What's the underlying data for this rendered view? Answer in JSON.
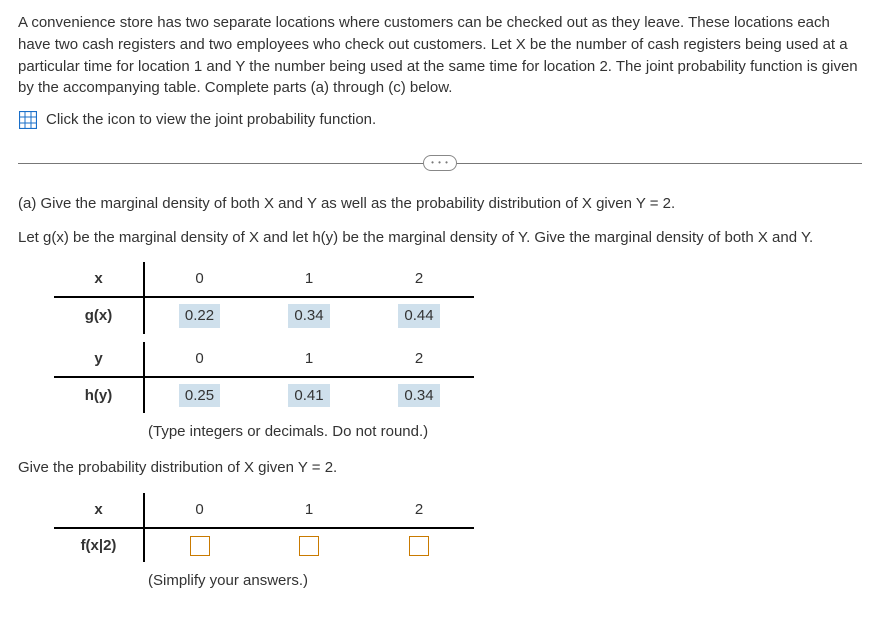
{
  "problem": {
    "text": "A convenience store has two separate locations where customers can be checked out as they leave. These locations each have two cash registers and two employees who check out customers. Let X be the number of cash registers being used at a particular time for location 1 and Y the number being used at the same time for location 2. The joint probability function is given by the accompanying table. Complete parts (a) through (c) below.",
    "iconLink": "Click the icon to view the joint probability function."
  },
  "partA": {
    "label": "(a) Give the marginal density of both X and Y as well as the probability distribution of X given Y = 2.",
    "instr": "Let g(x) be the marginal density of X and let h(y) be the marginal density of Y. Give the marginal density of both X and Y."
  },
  "gx": {
    "rowLabel": "x",
    "fnLabel": "g(x)",
    "cols": [
      "0",
      "1",
      "2"
    ],
    "vals": [
      "0.22",
      "0.34",
      "0.44"
    ]
  },
  "hy": {
    "rowLabel": "y",
    "fnLabel": "h(y)",
    "cols": [
      "0",
      "1",
      "2"
    ],
    "vals": [
      "0.25",
      "0.41",
      "0.34"
    ]
  },
  "hint1": "(Type integers or decimals. Do not round.)",
  "cond": {
    "prompt": "Give the probability distribution of X given Y = 2.",
    "rowLabel": "x",
    "fnLabel": "f(x|2)",
    "cols": [
      "0",
      "1",
      "2"
    ]
  },
  "hint2": "(Simplify your answers.)",
  "pill": "• • •"
}
